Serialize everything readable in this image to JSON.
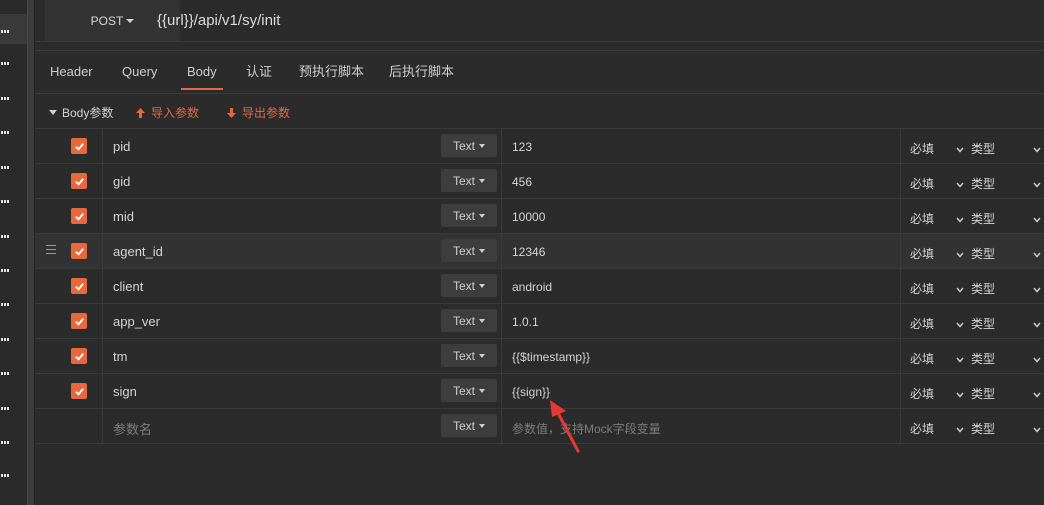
{
  "request": {
    "method": "POST",
    "url": "{{url}}/api/v1/sy/init"
  },
  "tabs": [
    {
      "label": "Header",
      "active": false
    },
    {
      "label": "Query",
      "active": false
    },
    {
      "label": "Body",
      "active": true
    },
    {
      "label": "认证",
      "active": false
    },
    {
      "label": "预执行脚本",
      "active": false
    },
    {
      "label": "后执行脚本",
      "active": false
    }
  ],
  "body_bar": {
    "section_label": "Body参数",
    "import_label": "导入参数",
    "export_label": "导出参数"
  },
  "params": [
    {
      "checked": true,
      "name": "pid",
      "type": "Text",
      "value": "123",
      "required": "必填",
      "kind": "类型"
    },
    {
      "checked": true,
      "name": "gid",
      "type": "Text",
      "value": "456",
      "required": "必填",
      "kind": "类型"
    },
    {
      "checked": true,
      "name": "mid",
      "type": "Text",
      "value": "10000",
      "required": "必填",
      "kind": "类型"
    },
    {
      "checked": true,
      "name": "agent_id",
      "type": "Text",
      "value": "12346",
      "required": "必填",
      "kind": "类型"
    },
    {
      "checked": true,
      "name": "client",
      "type": "Text",
      "value": "android",
      "required": "必填",
      "kind": "类型"
    },
    {
      "checked": true,
      "name": "app_ver",
      "type": "Text",
      "value": "1.0.1",
      "required": "必填",
      "kind": "类型"
    },
    {
      "checked": true,
      "name": "tm",
      "type": "Text",
      "value": "{{$timestamp}}",
      "required": "必填",
      "kind": "类型"
    },
    {
      "checked": true,
      "name": "sign",
      "type": "Text",
      "value": "{{sign}}",
      "required": "必填",
      "kind": "类型"
    }
  ],
  "new_param": {
    "name_placeholder": "参数名",
    "type": "Text",
    "value_placeholder": "参数值，支持Mock字段变量",
    "required": "必填",
    "kind": "类型"
  },
  "colors": {
    "accent": "#e8683d",
    "background": "#2b2b2b",
    "annotation_arrow": "#e53935"
  },
  "icons": {
    "checkbox": "check-icon",
    "import": "arrow-up-icon",
    "export": "arrow-down-icon",
    "drag": "drag-handle-icon"
  }
}
